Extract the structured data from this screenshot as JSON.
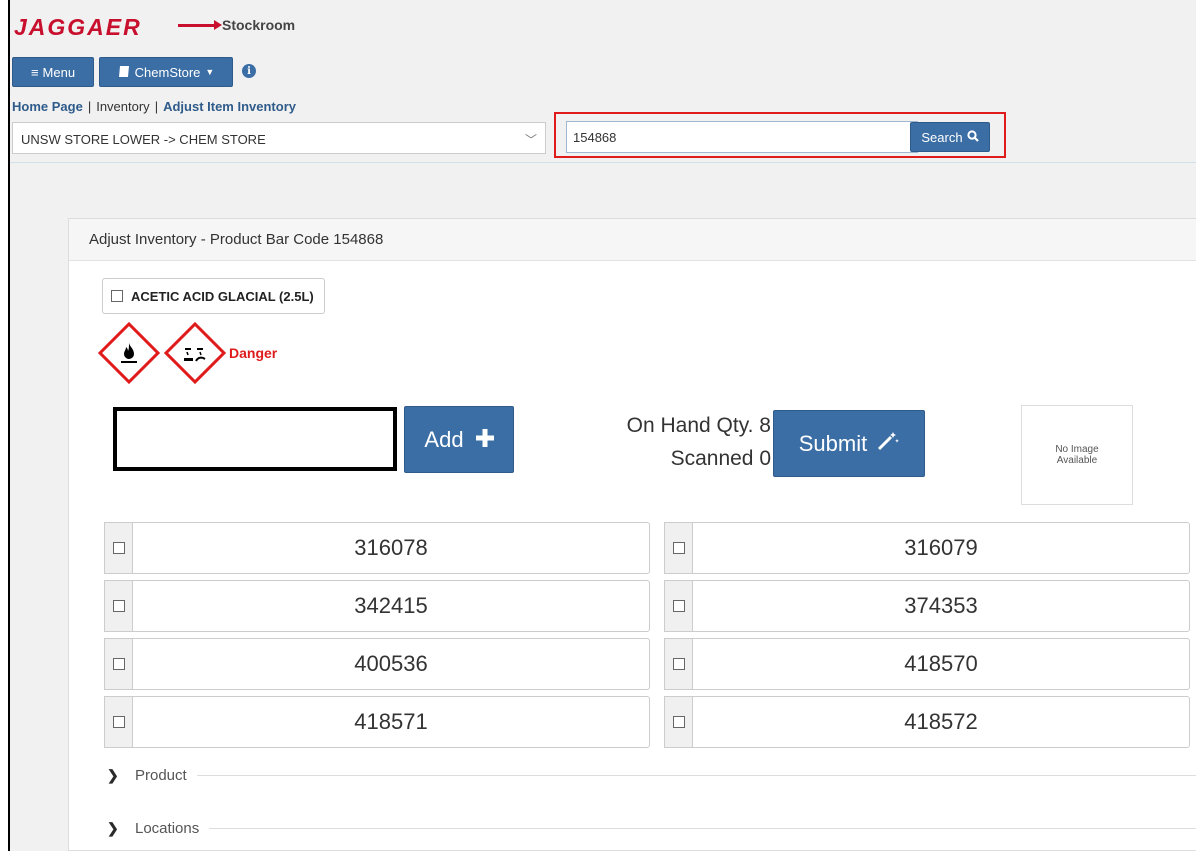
{
  "header": {
    "logo": "JAGGAER",
    "app_name": "Stockroom",
    "menu_label": "Menu",
    "store_button_label": "ChemStore"
  },
  "breadcrumb": {
    "home": "Home Page",
    "inventory": "Inventory",
    "current": "Adjust Item Inventory"
  },
  "store_selector": {
    "value": "UNSW STORE LOWER -> CHEM STORE"
  },
  "search": {
    "value": "154868",
    "button_label": "Search"
  },
  "panel": {
    "title": "Adjust Inventory - Product Bar Code 154868",
    "product_name": "ACETIC ACID GLACIAL (2.5L)",
    "signal_word": "Danger",
    "add_label": "Add",
    "on_hand_label": "On Hand Qty. 8",
    "scanned_label": "Scanned  0",
    "submit_label": "Submit",
    "no_image_line1": "No Image",
    "no_image_line2": "Available",
    "barcodes": [
      "316078",
      "316079",
      "342415",
      "374353",
      "400536",
      "418570",
      "418571",
      "418572"
    ],
    "sections": [
      "Product",
      "Locations"
    ]
  },
  "icons": {
    "hazard_1": "flame-icon",
    "hazard_2": "corrosion-icon"
  },
  "colors": {
    "accent_blue": "#3b6ea5",
    "brand_red": "#c8102e",
    "highlight_red": "#e01b1b"
  }
}
